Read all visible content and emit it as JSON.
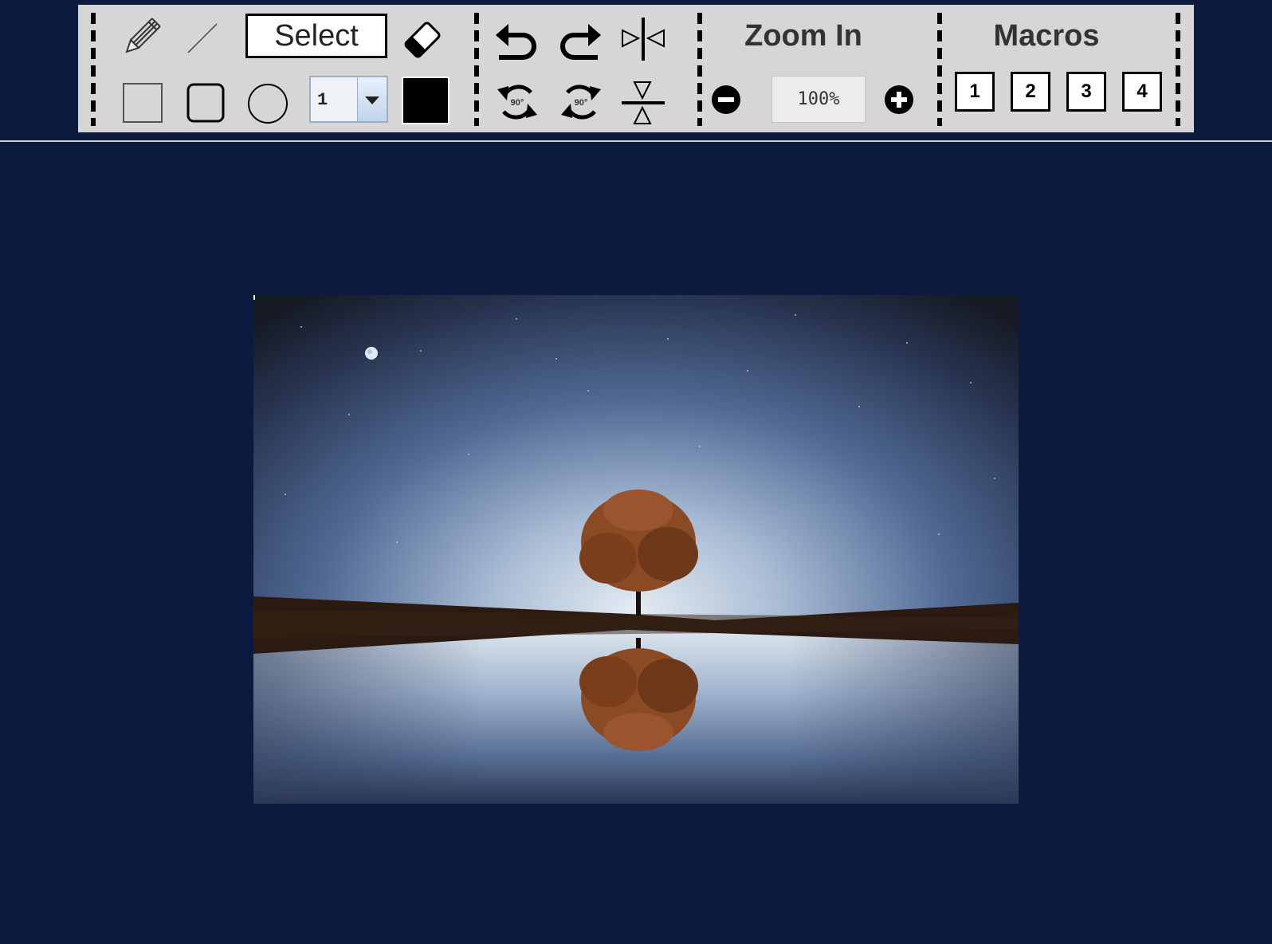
{
  "toolbar": {
    "tools": {
      "pencil": "pencil-icon",
      "line": "line-icon",
      "select_label": "Select",
      "eraser": "eraser-icon",
      "rectangle": "rectangle-icon",
      "rounded_rectangle": "rounded-rectangle-icon",
      "ellipse": "ellipse-icon",
      "line_width": "1",
      "color": "#000000"
    },
    "edit": {
      "undo": "undo-icon",
      "redo": "redo-icon",
      "flip_horizontal": "flip-horizontal-icon",
      "rotate_left_label": "90°",
      "rotate_right_label": "90°",
      "flip_vertical": "flip-vertical-icon"
    },
    "zoom": {
      "title": "Zoom In",
      "value": "100%",
      "zoom_out": "minus-circle-icon",
      "zoom_in": "plus-circle-icon"
    },
    "macros": {
      "title": "Macros",
      "buttons": [
        "1",
        "2",
        "3",
        "4"
      ]
    }
  },
  "colors": {
    "page_background": "#0c1a40",
    "toolbar_background": "#d6d6d6"
  },
  "canvas": {
    "image": "night-tree-reflection-photo"
  }
}
